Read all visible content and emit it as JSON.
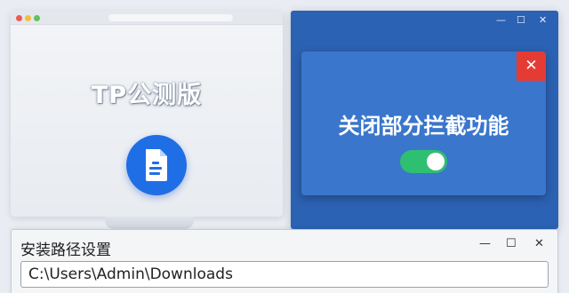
{
  "left_window": {
    "app_title": "TP公测版",
    "logo_icon": "document-icon"
  },
  "right_window": {
    "controls": {
      "minimize": "—",
      "maximize": "☐",
      "close": "✕"
    },
    "dialog": {
      "title": "关闭部分拦截功能",
      "close": "✕",
      "toggle_on": true
    }
  },
  "install_window": {
    "title": "安装路径设置",
    "controls": {
      "minimize": "—",
      "maximize": "☐",
      "close": "✕"
    },
    "path_value": "C:\\Users\\Admin\\Downloads"
  },
  "colors": {
    "accent_blue": "#1f6ee6",
    "dialog_blue": "#3a76cc",
    "close_red": "#e53b35",
    "toggle_green": "#2fbf71"
  }
}
